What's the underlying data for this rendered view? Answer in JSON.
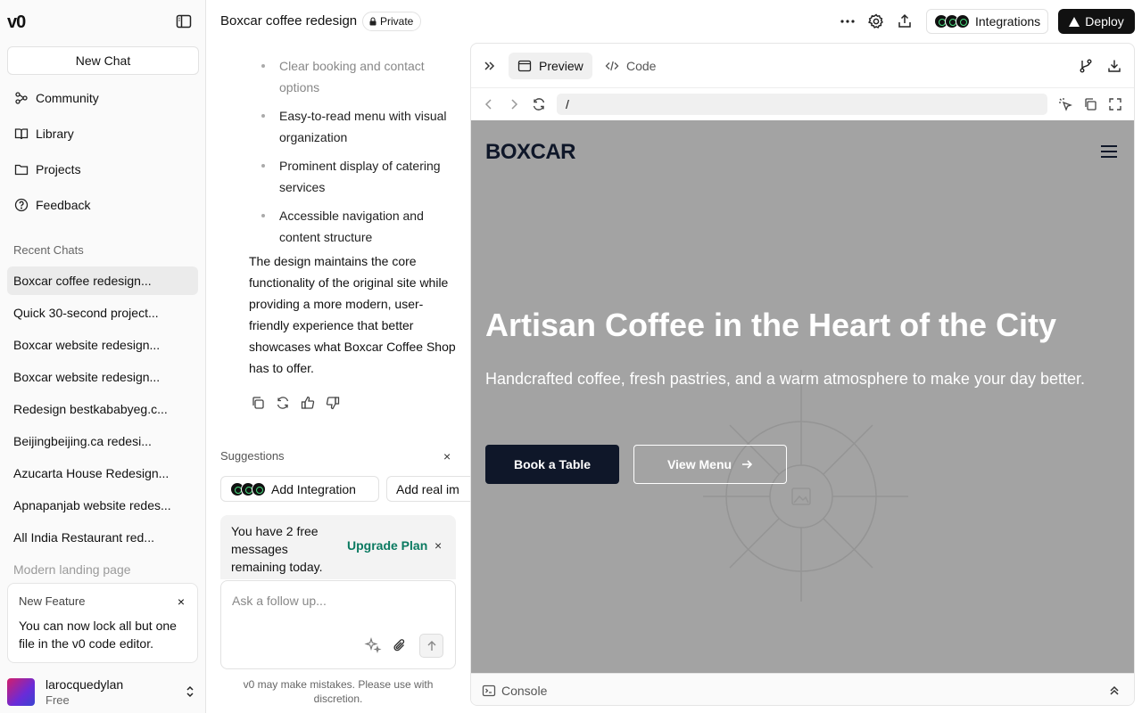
{
  "sidebar": {
    "logo": "v0",
    "new_chat": "New Chat",
    "nav": [
      {
        "label": "Community",
        "icon": "community-icon"
      },
      {
        "label": "Library",
        "icon": "book-icon"
      },
      {
        "label": "Projects",
        "icon": "folder-icon"
      },
      {
        "label": "Feedback",
        "icon": "help-circle-icon"
      }
    ],
    "recent_header": "Recent Chats",
    "chats": [
      "Boxcar coffee redesign...",
      "Quick 30-second project...",
      "Boxcar website redesign...",
      "Boxcar website redesign...",
      "Redesign bestkababyeg.c...",
      "Beijingbeijing.ca redesi...",
      "Azucarta House Redesign...",
      "Apnapanjab website redes...",
      "All India Restaurant red...",
      "Modern landing page"
    ],
    "feature": {
      "title": "New Feature",
      "body": "You can now lock all but one file in the v0 code editor.",
      "close": "×"
    },
    "user": {
      "name": "larocquedylan",
      "plan": "Free"
    }
  },
  "topbar": {
    "project_title": "Boxcar coffee redesign",
    "private_label": "Private",
    "integrations_label": "Integrations",
    "deploy_label": "Deploy"
  },
  "chat": {
    "bullets": [
      "Clear booking and contact options",
      "Easy-to-read menu with visual organization",
      "Prominent display of catering services",
      "Accessible navigation and content structure"
    ],
    "paragraph": "The design maintains the core functionality of the original site while providing a more modern, user-friendly experience that better showcases what Boxcar Coffee Shop has to offer.",
    "suggestions_label": "Suggestions",
    "suggestions_close": "×",
    "chips": [
      "Add Integration",
      "Add real im"
    ],
    "notice_text": "You have 2 free messages remaining today.",
    "upgrade_label": "Upgrade Plan",
    "notice_close": "×",
    "input_placeholder": "Ask a follow up...",
    "disclaimer": "v0 may make mistakes. Please use with discretion."
  },
  "panel": {
    "tabs": [
      {
        "label": "Preview",
        "active": true
      },
      {
        "label": "Code",
        "active": false
      }
    ],
    "url": "/",
    "console_label": "Console",
    "site": {
      "logo": "BOXCAR",
      "hero_title": "Artisan Coffee in the Heart of the City",
      "hero_sub": "Handcrafted coffee, fresh pastries, and a warm atmosphere to make your day better.",
      "primary_btn": "Book a Table",
      "secondary_btn": "View Menu"
    }
  },
  "colors": {
    "accent": "#0b7a61",
    "site_bg": "#a3a3a3",
    "site_dark": "#0f1729",
    "deploy_bg": "#111111"
  }
}
